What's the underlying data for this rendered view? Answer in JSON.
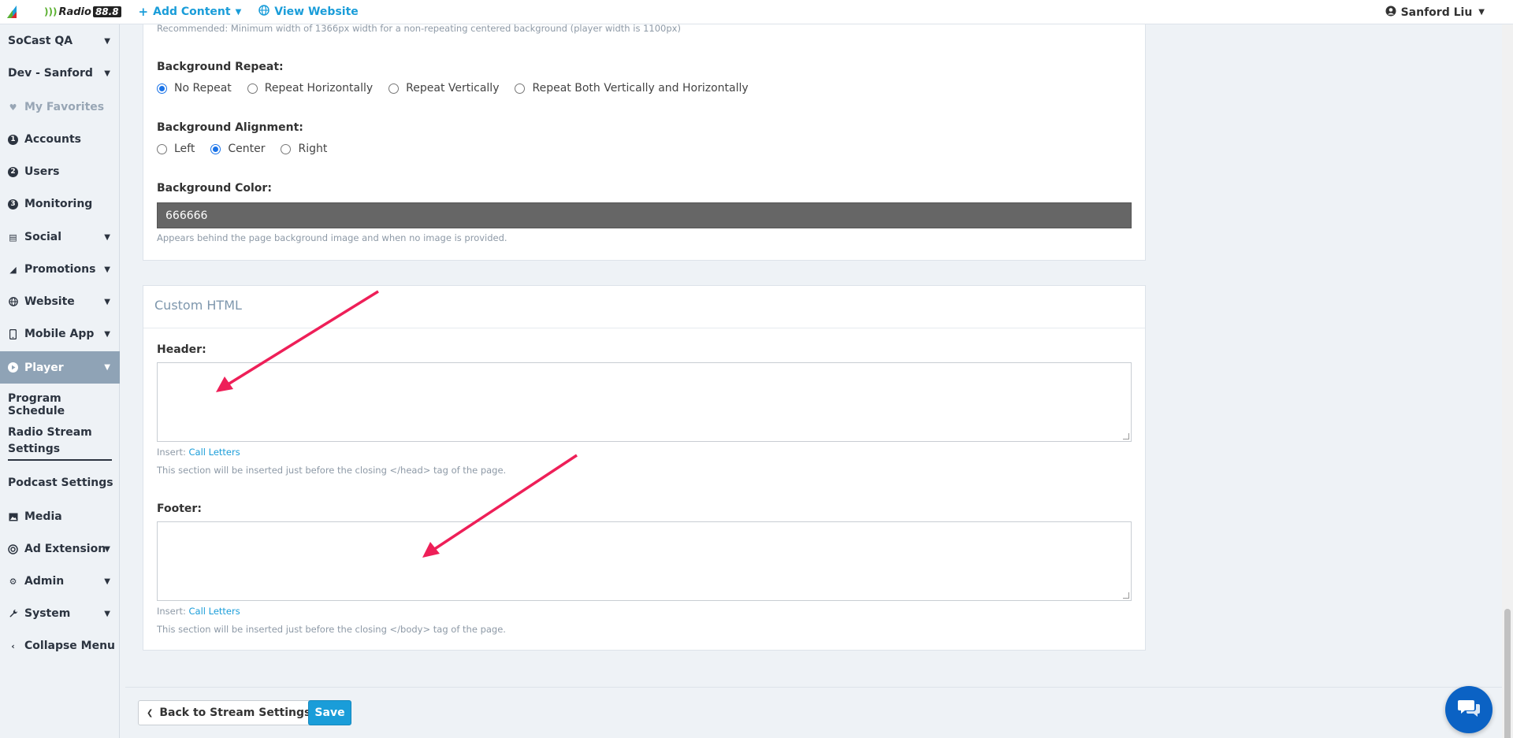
{
  "topbar": {
    "brand": "Radio",
    "brand_number": "88.8",
    "add_content": "Add Content",
    "view_website": "View Website",
    "user_name": "Sanford Liu"
  },
  "sidebar": {
    "items": [
      {
        "label": "SoCast QA"
      },
      {
        "label": "Dev - Sanford"
      },
      {
        "label": "My Favorites"
      },
      {
        "label": "Accounts",
        "badge": "1"
      },
      {
        "label": "Users",
        "badge": "2"
      },
      {
        "label": "Monitoring",
        "badge": "3"
      },
      {
        "label": "Social"
      },
      {
        "label": "Promotions"
      },
      {
        "label": "Website"
      },
      {
        "label": "Mobile App"
      },
      {
        "label": "Player"
      },
      {
        "label": "Program Schedule"
      },
      {
        "label": "Radio Stream Settings"
      },
      {
        "label": "Podcast Settings"
      },
      {
        "label": "Media"
      },
      {
        "label": "Ad Extension"
      },
      {
        "label": "Admin"
      },
      {
        "label": "System"
      },
      {
        "label": "Collapse Menu"
      }
    ]
  },
  "background": {
    "recommended_hint": "Recommended: Minimum width of 1366px width for a non-repeating centered background (player width is 1100px)",
    "repeat_label": "Background Repeat:",
    "repeat_options": [
      "No Repeat",
      "Repeat Horizontally",
      "Repeat Vertically",
      "Repeat Both Vertically and Horizontally"
    ],
    "repeat_selected": "No Repeat",
    "alignment_label": "Background Alignment:",
    "alignment_options": [
      "Left",
      "Center",
      "Right"
    ],
    "alignment_selected": "Center",
    "color_label": "Background Color:",
    "color_value": "666666",
    "color_hint": "Appears behind the page background image and when no image is provided."
  },
  "custom_html": {
    "title": "Custom HTML",
    "header_label": "Header:",
    "header_value": "",
    "header_insert": "Insert:",
    "header_insert_link": "Call Letters",
    "header_hint": "This section will be inserted just before the closing </head> tag of the page.",
    "footer_label": "Footer:",
    "footer_value": "",
    "footer_insert": "Insert:",
    "footer_insert_link": "Call Letters",
    "footer_hint": "This section will be inserted just before the closing </body> tag of the page."
  },
  "actions": {
    "back_label": "Back to Stream Settings",
    "save_label": "Save"
  },
  "colors": {
    "accent": "#1a9dd9",
    "sidebar_active": "#8fa3b6",
    "annotation_arrow": "#ee1f58",
    "chat_button": "#0b62c4"
  }
}
